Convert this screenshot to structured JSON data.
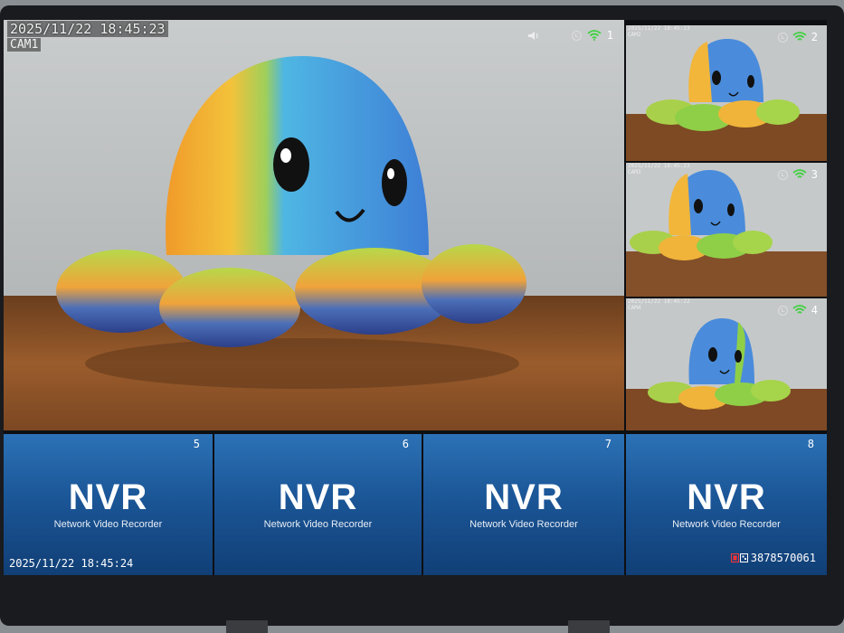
{
  "main_camera": {
    "timestamp": "2025/11/22  18:45:23",
    "name": "CAM1",
    "channel": "1",
    "icons": [
      "speaker-icon",
      "record-icon",
      "wifi-icon"
    ]
  },
  "side_cameras": [
    {
      "channel": "2",
      "timestamp": "2025/11/22 18:45:23",
      "name": "CAM2"
    },
    {
      "channel": "3",
      "timestamp": "2025/11/22 18:45:23",
      "name": "CAM3"
    },
    {
      "channel": "4",
      "timestamp": "2025/11/22 18:45:22",
      "name": "CAM4"
    }
  ],
  "nvr_tiles": [
    {
      "channel": "5",
      "logo": "NVR",
      "subtitle": "Network Video Recorder"
    },
    {
      "channel": "6",
      "logo": "NVR",
      "subtitle": "Network Video Recorder"
    },
    {
      "channel": "7",
      "logo": "NVR",
      "subtitle": "Network Video Recorder"
    },
    {
      "channel": "8",
      "logo": "NVR",
      "subtitle": "Network Video Recorder"
    }
  ],
  "footer": {
    "time": "2025/11/22  18:45:24",
    "device_id": "3878570061"
  },
  "colors": {
    "tile_blue": "#1b5697",
    "wifi_green": "#3fd13f"
  }
}
